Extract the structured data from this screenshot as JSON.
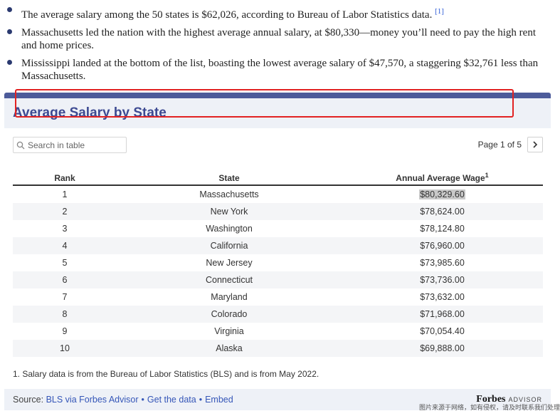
{
  "bullets": [
    {
      "text": "The average salary among the 50 states is $62,026, according to Bureau of Labor Statistics data.",
      "ref": "[1]"
    },
    {
      "text": "Massachusetts led the nation with the highest average annual salary, at $80,330—money you’ll need to pay the high rent and home prices."
    },
    {
      "text": "Mississippi landed at the bottom of the list, boasting the lowest average salary of $47,570, a staggering $32,761 less than Massachusetts."
    }
  ],
  "widget": {
    "title": "Average Salary by State",
    "search": {
      "placeholder": "Search in table"
    },
    "pager": {
      "text": "Page 1 of 5"
    },
    "columns": {
      "rank": "Rank",
      "state": "State",
      "wage": "Annual Average Wage",
      "wage_sup": "1"
    },
    "rows": [
      {
        "rank": "1",
        "state": "Massachusetts",
        "wage": "$80,329.60"
      },
      {
        "rank": "2",
        "state": "New York",
        "wage": "$78,624.00"
      },
      {
        "rank": "3",
        "state": "Washington",
        "wage": "$78,124.80"
      },
      {
        "rank": "4",
        "state": "California",
        "wage": "$76,960.00"
      },
      {
        "rank": "5",
        "state": "New Jersey",
        "wage": "$73,985.60"
      },
      {
        "rank": "6",
        "state": "Connecticut",
        "wage": "$73,736.00"
      },
      {
        "rank": "7",
        "state": "Maryland",
        "wage": "$73,632.00"
      },
      {
        "rank": "8",
        "state": "Colorado",
        "wage": "$71,968.00"
      },
      {
        "rank": "9",
        "state": "Virginia",
        "wage": "$70,054.40"
      },
      {
        "rank": "10",
        "state": "Alaska",
        "wage": "$69,888.00"
      }
    ],
    "footnote": "1. Salary data is from the Bureau of Labor Statistics (BLS) and is from May 2022.",
    "source": {
      "label": "Source:",
      "link1": "BLS via Forbes Advisor",
      "sep": "•",
      "link2": "Get the data",
      "link3": "Embed"
    },
    "brand": {
      "name": "Forbes",
      "suffix": "ADVISOR"
    }
  },
  "watermark": "图片来源于网络，如有侵权，请及时联系我们处理",
  "colors": {
    "accent": "#4c5b9a",
    "title": "#3d4a92",
    "highlight": "#e22222",
    "link": "#3556b8"
  }
}
